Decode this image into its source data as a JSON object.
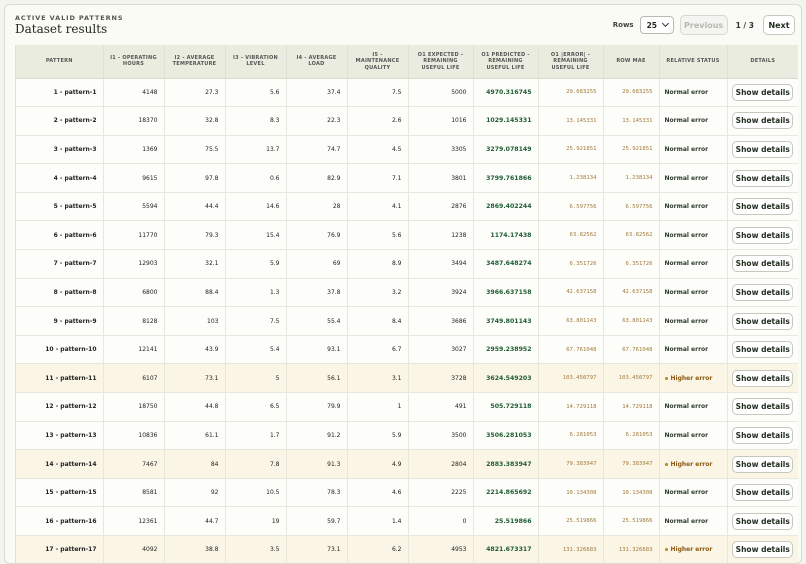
{
  "header": {
    "eyebrow": "ACTIVE VALID PATTERNS",
    "title": "Dataset results"
  },
  "pager": {
    "rows_label": "Rows",
    "rows_value": "25",
    "prev_label": "Previous",
    "page_indicator": "1 / 3",
    "next_label": "Next"
  },
  "columns": [
    "PATTERN",
    "I1 - OPERATING HOURS",
    "I2 - AVERAGE TEMPERATURE",
    "I3 - VIBRATION LEVEL",
    "I4 - AVERAGE LOAD",
    "I5 - MAINTENANCE QUALITY",
    "O1 EXPECTED - REMAINING USEFUL LIFE",
    "O1 PREDICTED - REMAINING USEFUL LIFE",
    "O1 |ERROR| - REMAINING USEFUL LIFE",
    "ROW MAE",
    "RELATIVE STATUS",
    "DETAILS"
  ],
  "rows": [
    {
      "pattern": "1 - pattern-1",
      "i1": "4148",
      "i2": "27.3",
      "i3": "5.6",
      "i4": "37.4",
      "i5": "7.5",
      "expected": "5000",
      "predicted": "4970.316745",
      "error": "29.683255",
      "mae": "29.683255",
      "status": "Normal error",
      "high": false,
      "details": "Show details"
    },
    {
      "pattern": "2 - pattern-2",
      "i1": "18370",
      "i2": "32.8",
      "i3": "8.3",
      "i4": "22.3",
      "i5": "2.6",
      "expected": "1016",
      "predicted": "1029.145331",
      "error": "13.145331",
      "mae": "13.145331",
      "status": "Normal error",
      "high": false,
      "details": "Show details"
    },
    {
      "pattern": "3 - pattern-3",
      "i1": "1369",
      "i2": "75.5",
      "i3": "13.7",
      "i4": "74.7",
      "i5": "4.5",
      "expected": "3305",
      "predicted": "3279.078149",
      "error": "25.921851",
      "mae": "25.921851",
      "status": "Normal error",
      "high": false,
      "details": "Show details"
    },
    {
      "pattern": "4 - pattern-4",
      "i1": "9615",
      "i2": "97.8",
      "i3": "0.6",
      "i4": "82.9",
      "i5": "7.1",
      "expected": "3801",
      "predicted": "3799.761866",
      "error": "1.238134",
      "mae": "1.238134",
      "status": "Normal error",
      "high": false,
      "details": "Show details"
    },
    {
      "pattern": "5 - pattern-5",
      "i1": "5594",
      "i2": "44.4",
      "i3": "14.6",
      "i4": "28",
      "i5": "4.1",
      "expected": "2876",
      "predicted": "2869.402244",
      "error": "6.597756",
      "mae": "6.597756",
      "status": "Normal error",
      "high": false,
      "details": "Show details"
    },
    {
      "pattern": "6 - pattern-6",
      "i1": "11770",
      "i2": "79.3",
      "i3": "15.4",
      "i4": "76.9",
      "i5": "5.6",
      "expected": "1238",
      "predicted": "1174.17438",
      "error": "63.82562",
      "mae": "63.82562",
      "status": "Normal error",
      "high": false,
      "details": "Show details"
    },
    {
      "pattern": "7 - pattern-7",
      "i1": "12903",
      "i2": "32.1",
      "i3": "5.9",
      "i4": "69",
      "i5": "8.9",
      "expected": "3494",
      "predicted": "3487.648274",
      "error": "6.351726",
      "mae": "6.351726",
      "status": "Normal error",
      "high": false,
      "details": "Show details"
    },
    {
      "pattern": "8 - pattern-8",
      "i1": "6800",
      "i2": "88.4",
      "i3": "1.3",
      "i4": "37.8",
      "i5": "3.2",
      "expected": "3924",
      "predicted": "3966.637158",
      "error": "42.637158",
      "mae": "42.637158",
      "status": "Normal error",
      "high": false,
      "details": "Show details"
    },
    {
      "pattern": "9 - pattern-9",
      "i1": "8128",
      "i2": "103",
      "i3": "7.5",
      "i4": "55.4",
      "i5": "8.4",
      "expected": "3686",
      "predicted": "3749.801143",
      "error": "63.801143",
      "mae": "63.801143",
      "status": "Normal error",
      "high": false,
      "details": "Show details"
    },
    {
      "pattern": "10 - pattern-10",
      "i1": "12141",
      "i2": "43.9",
      "i3": "5.4",
      "i4": "93.1",
      "i5": "6.7",
      "expected": "3027",
      "predicted": "2959.238952",
      "error": "67.761048",
      "mae": "67.761048",
      "status": "Normal error",
      "high": false,
      "details": "Show details"
    },
    {
      "pattern": "11 - pattern-11",
      "i1": "6107",
      "i2": "73.1",
      "i3": "5",
      "i4": "56.1",
      "i5": "3.1",
      "expected": "3728",
      "predicted": "3624.549203",
      "error": "103.450797",
      "mae": "103.450797",
      "status": "Higher error",
      "high": true,
      "details": "Show details"
    },
    {
      "pattern": "12 - pattern-12",
      "i1": "18750",
      "i2": "44.8",
      "i3": "6.5",
      "i4": "79.9",
      "i5": "1",
      "expected": "491",
      "predicted": "505.729118",
      "error": "14.729118",
      "mae": "14.729118",
      "status": "Normal error",
      "high": false,
      "details": "Show details"
    },
    {
      "pattern": "13 - pattern-13",
      "i1": "10836",
      "i2": "61.1",
      "i3": "1.7",
      "i4": "91.2",
      "i5": "5.9",
      "expected": "3500",
      "predicted": "3506.281053",
      "error": "6.281053",
      "mae": "6.281053",
      "status": "Normal error",
      "high": false,
      "details": "Show details"
    },
    {
      "pattern": "14 - pattern-14",
      "i1": "7467",
      "i2": "84",
      "i3": "7.8",
      "i4": "91.3",
      "i5": "4.9",
      "expected": "2804",
      "predicted": "2883.383947",
      "error": "79.383947",
      "mae": "79.383947",
      "status": "Higher error",
      "high": true,
      "details": "Show details"
    },
    {
      "pattern": "15 - pattern-15",
      "i1": "8581",
      "i2": "92",
      "i3": "10.5",
      "i4": "78.3",
      "i5": "4.6",
      "expected": "2225",
      "predicted": "2214.865692",
      "error": "10.134308",
      "mae": "10.134308",
      "status": "Normal error",
      "high": false,
      "details": "Show details"
    },
    {
      "pattern": "16 - pattern-16",
      "i1": "12361",
      "i2": "44.7",
      "i3": "19",
      "i4": "59.7",
      "i5": "1.4",
      "expected": "0",
      "predicted": "25.519866",
      "error": "25.519866",
      "mae": "25.519866",
      "status": "Normal error",
      "high": false,
      "details": "Show details"
    },
    {
      "pattern": "17 - pattern-17",
      "i1": "4092",
      "i2": "38.8",
      "i3": "3.5",
      "i4": "73.1",
      "i5": "6.2",
      "expected": "4953",
      "predicted": "4821.673317",
      "error": "131.326683",
      "mae": "131.326683",
      "status": "Higher error",
      "high": true,
      "details": "Show details"
    }
  ],
  "colors": {
    "accent_green": "#1e5c34",
    "error_amber": "#a17a3d",
    "high_row_bg": "#fbf5e6",
    "header_bg": "#eaecdf"
  }
}
